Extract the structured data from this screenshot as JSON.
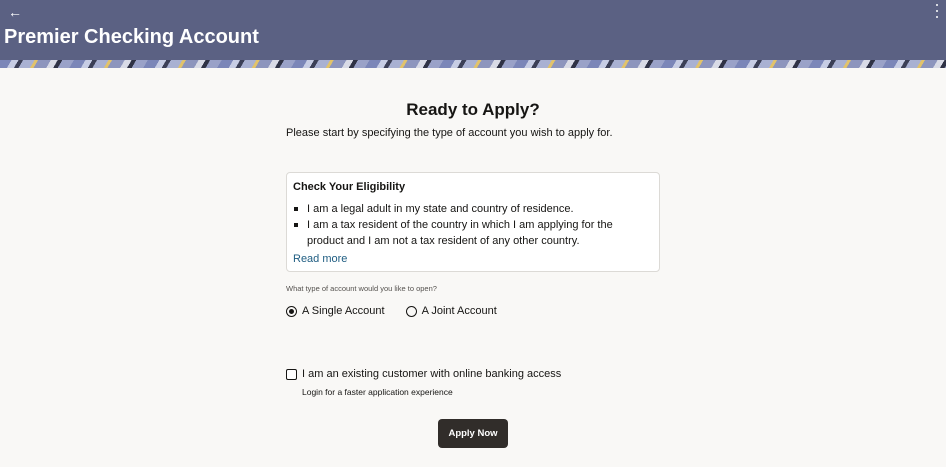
{
  "header": {
    "back_icon": "arrow-left-icon",
    "menu_icon": "kebab-menu-icon",
    "title": "Premier Checking Account",
    "background_color": "#5b6183"
  },
  "main": {
    "heading": "Ready to Apply?",
    "subheading": "Please start by specifying the type of account you wish to apply for.",
    "eligibility": {
      "title": "Check Your Eligibility",
      "items": [
        "I am a legal adult in my state and country of residence.",
        "I am a tax resident of the country in which I am applying for the product and I am not a tax resident of any other country."
      ],
      "read_more": "Read more"
    },
    "account_type": {
      "question": "What type of account would you like to open?",
      "options": [
        {
          "label": "A Single Account",
          "selected": true
        },
        {
          "label": "A Joint Account",
          "selected": false
        }
      ]
    },
    "existing_customer": {
      "label": "I am an existing customer with online banking access",
      "checked": false,
      "hint": "Login for a faster application experience"
    },
    "apply_button": "Apply Now",
    "link_color": "#1f5d82",
    "button_color": "#312d2a"
  }
}
